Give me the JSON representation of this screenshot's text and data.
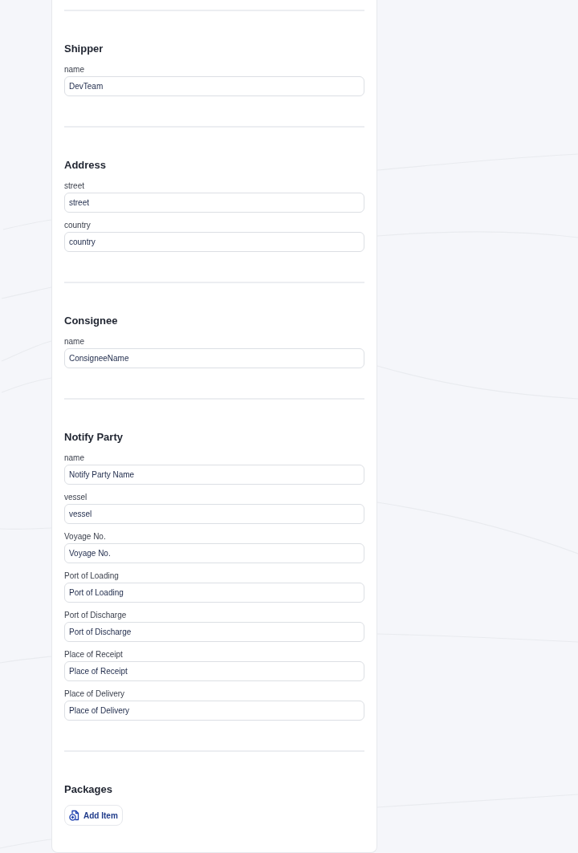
{
  "sections": [
    {
      "title": "Shipper",
      "fields": [
        {
          "label": "name",
          "value": "DevTeam"
        }
      ]
    },
    {
      "title": "Address",
      "fields": [
        {
          "label": "street",
          "value": "street"
        },
        {
          "label": "country",
          "value": "country"
        }
      ]
    },
    {
      "title": "Consignee",
      "fields": [
        {
          "label": "name",
          "value": "ConsigneeName"
        }
      ]
    },
    {
      "title": "Notify Party",
      "fields": [
        {
          "label": "name",
          "value": "Notify Party Name"
        },
        {
          "label": "vessel",
          "value": "vessel"
        },
        {
          "label": "Voyage No.",
          "value": "Voyage No."
        },
        {
          "label": "Port of Loading",
          "value": "Port of Loading"
        },
        {
          "label": "Port of Discharge",
          "value": "Port of Discharge"
        },
        {
          "label": "Place of Receipt",
          "value": "Place of Receipt"
        },
        {
          "label": "Place of Delivery",
          "value": "Place of Delivery"
        }
      ]
    }
  ],
  "packages": {
    "title": "Packages",
    "add_button": "Add Item"
  }
}
